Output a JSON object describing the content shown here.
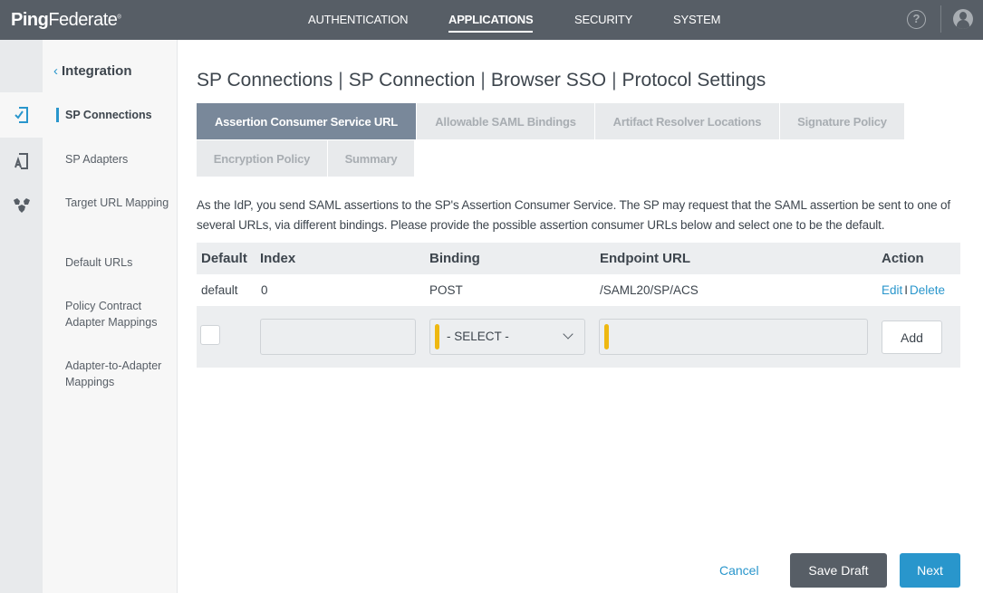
{
  "header": {
    "logo_bold": "Ping",
    "logo_light": "Federate",
    "logo_mark": "®",
    "nav": [
      {
        "label": "AUTHENTICATION",
        "active": false
      },
      {
        "label": "APPLICATIONS",
        "active": true
      },
      {
        "label": "SECURITY",
        "active": false
      },
      {
        "label": "SYSTEM",
        "active": false
      }
    ],
    "help_glyph": "?",
    "icons": [
      "help-icon",
      "user-icon"
    ]
  },
  "rail": {
    "items": [
      {
        "icon": "sp-connections-icon",
        "active": true
      },
      {
        "icon": "sp-adapters-icon",
        "active": false
      },
      {
        "icon": "target-mapping-icon",
        "active": false
      }
    ]
  },
  "subnav": {
    "back_glyph": "‹",
    "back_label": "Integration",
    "items": [
      {
        "label": "SP Connections",
        "active": true
      },
      {
        "label": "SP Adapters",
        "active": false
      },
      {
        "label": "Target URL Mapping",
        "active": false
      },
      {
        "label": "Default URLs",
        "active": false
      },
      {
        "label": "Policy Contract Adapter Mappings",
        "active": false
      },
      {
        "label": "Adapter-to-Adapter Mappings",
        "active": false
      }
    ]
  },
  "main": {
    "breadcrumb": [
      "SP Connections",
      "SP Connection",
      "Browser SSO",
      "Protocol Settings"
    ],
    "separator": "|",
    "tabs": [
      {
        "label": "Assertion Consumer Service URL",
        "active": true
      },
      {
        "label": "Allowable SAML Bindings",
        "active": false
      },
      {
        "label": "Artifact Resolver Locations",
        "active": false
      },
      {
        "label": "Signature Policy",
        "active": false
      },
      {
        "label": "Encryption Policy",
        "active": false
      },
      {
        "label": "Summary",
        "active": false
      }
    ],
    "description": "As the IdP, you send SAML assertions to the SP's Assertion Consumer Service. The SP may request that the SAML assertion be sent to one of several URLs, via different bindings. Please provide the possible assertion consumer URLs below and select one to be the default.",
    "table": {
      "columns": [
        "Default",
        "Index",
        "Binding",
        "Endpoint URL",
        "Action"
      ],
      "rows": [
        {
          "default": "default",
          "index": "0",
          "binding": "POST",
          "endpoint": "/SAML20/SP/ACS",
          "actions": [
            "Edit",
            "Delete"
          ]
        }
      ],
      "action_separator": "I"
    },
    "new_row": {
      "default_checked": false,
      "index_value": "",
      "binding_value": "- SELECT -",
      "endpoint_value": "",
      "add_label": "Add"
    }
  },
  "footer": {
    "cancel_label": "Cancel",
    "save_draft_label": "Save Draft",
    "next_label": "Next"
  },
  "colors": {
    "header_bg": "#575e66",
    "accent_blue": "#2996cc",
    "active_tab": "#79889a",
    "required_marker": "#eeb811"
  }
}
